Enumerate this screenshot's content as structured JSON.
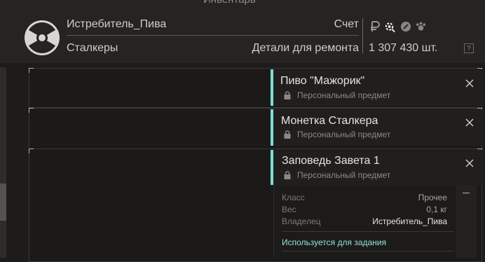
{
  "window": {
    "title": "Инвентарь"
  },
  "header": {
    "player_name": "Истребитель_Пива",
    "group": "Сталкеры",
    "account_label": "Счет",
    "category_label": "Детали для ремонта",
    "amount": "1 307 430 шт.",
    "help_label": "?",
    "currency_icons": [
      "ruble-icon",
      "gear-parts-icon",
      "wrench-coin-icon",
      "paw-icon"
    ]
  },
  "items": [
    {
      "title": "Пиво \"Мажорик\"",
      "subtitle": "Персональный предмет"
    },
    {
      "title": "Монетка Сталкера",
      "subtitle": "Персональный предмет"
    },
    {
      "title": "Заповедь Завета 1",
      "subtitle": "Персональный предмет"
    }
  ],
  "details": {
    "class_label": "Класс",
    "class_value": "Прочее",
    "weight_label": "Вес",
    "weight_value": "0,1 кг",
    "owner_label": "Владелец",
    "owner_value": "Истребитель_Пива",
    "quest_text": "Используется для задания"
  },
  "colors": {
    "accent": "#7ddfd6",
    "background": "#1e1c1b",
    "header": "#262322"
  }
}
